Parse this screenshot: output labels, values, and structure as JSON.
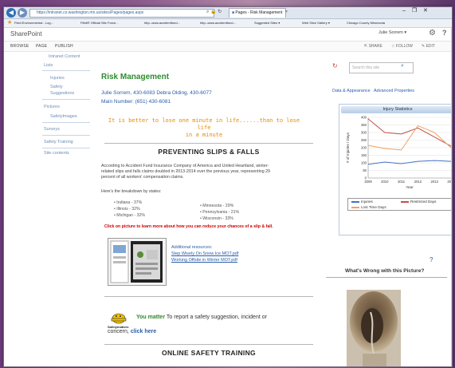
{
  "browser": {
    "url": "https://intranet.co.washington.mn.us/sites/Pages/pages.aspx",
    "tabs": [
      {
        "label": "Pages - Risk Management"
      },
      {
        "label": "×"
      }
    ],
    "window_controls": "– ❐ ✕",
    "favorites": [
      {
        "label": "Field Environmental - Log..."
      },
      {
        "label": "Fitbit® Official Site Force..."
      },
      {
        "label": "http--www.accidentfund..."
      },
      {
        "label": "http--www.accidentfund..."
      },
      {
        "label": "Suggested Sites ▾"
      },
      {
        "label": "Web Slice Gallery ▾"
      },
      {
        "label": "Chicago County Minnesota"
      }
    ]
  },
  "sharepoint": {
    "brand": "SharePoint",
    "user": "Julie Sorrem ▾",
    "ribbon_tabs": [
      "BROWSE",
      "PAGE",
      "PUBLISH"
    ],
    "actions": [
      "SHARE",
      "FOLLOW",
      "EDIT"
    ]
  },
  "leftnav": {
    "items": [
      {
        "label": "Intranet Content"
      },
      {
        "label": "Lists"
      },
      {
        "label": "Injuries"
      },
      {
        "label": "Safety"
      },
      {
        "label": "Suggestions"
      },
      {
        "label": "Pictures"
      },
      {
        "label": "SafetyImages"
      },
      {
        "label": "Surveys"
      },
      {
        "label": "Safety Training"
      },
      {
        "label": "Site contents"
      }
    ]
  },
  "main": {
    "title": "Risk Management",
    "contact_line": "Julie Sorrem, 430-6083 Debra Olding, 430-6077",
    "main_number": "Main Number: (651) 430-6081",
    "quote_line1": "It is better to lose one minute in life......than to lose life",
    "quote_line2": "in a minute",
    "section1_heading": "PREVENTING SLIPS & FALLS",
    "intro_line1": "According to Accident Fund Insurance Company of America and United Heartland, winter-",
    "intro_line2": "related slips and falls claims doubled in 2013-2014 over the previous year, representing 29",
    "intro_line3": "percent of all workers' compensation claims.",
    "breakdown_label": "Here's the breakdown by states:",
    "states": [
      {
        "label": "Indiana - 37%"
      },
      {
        "label": "Illinois - 32%"
      },
      {
        "label": "Michigan - 32%"
      },
      {
        "label": "Minnesota - 29%"
      },
      {
        "label": "Pennsylvania - 21%"
      },
      {
        "label": "Wisconsin - 33%"
      }
    ],
    "click_line": "Click on picture to learn more about how you can reduce your chances of a slip & fall.",
    "resources_title": "Additional resources:",
    "resource_links": [
      {
        "label": "Step Wisely On Snow Ice MOT.pdf"
      },
      {
        "label": "Working Offsite in Winter MOT.pdf"
      }
    ],
    "safety_logo_text": "Safetymatters",
    "you_matter": "You matter",
    "report_text_1": "To report a safety suggestion, incident or",
    "report_text_2": "concern,",
    "click_here": "click here",
    "section2_heading": "ONLINE SAFETY TRAINING"
  },
  "right": {
    "search_placeholder": "Search this site",
    "links": [
      "Data & Appearance",
      "Advanced Properties"
    ],
    "chart_title": "Injury Statistics",
    "photo_heading": "What's Wrong with this Picture?"
  },
  "chart_data": {
    "type": "line",
    "title": "Injury Statistics",
    "xlabel": "Year",
    "ylabel": "# of Injuries / Days",
    "x": [
      2009,
      2010,
      2011,
      2012,
      2013,
      2014
    ],
    "ylim": [
      0,
      400
    ],
    "yticks": [
      0,
      50,
      100,
      150,
      200,
      250,
      300,
      350,
      400
    ],
    "grid": true,
    "legend_position": "bottom",
    "series": [
      {
        "name": "Injuries",
        "color": "#4472c4",
        "values": [
          90,
          105,
          95,
          110,
          115,
          110
        ]
      },
      {
        "name": "Restricted Days",
        "color": "#c0504d",
        "values": [
          390,
          300,
          290,
          330,
          270,
          210
        ]
      },
      {
        "name": "Lost Time Days",
        "color": "#f0a060",
        "values": [
          215,
          195,
          185,
          345,
          300,
          200
        ]
      }
    ]
  },
  "colors": {
    "title_green": "#2e8b2e",
    "link_blue": "#2a5da8",
    "quote_orange": "#e88a00",
    "alert_red": "#cc0000"
  }
}
